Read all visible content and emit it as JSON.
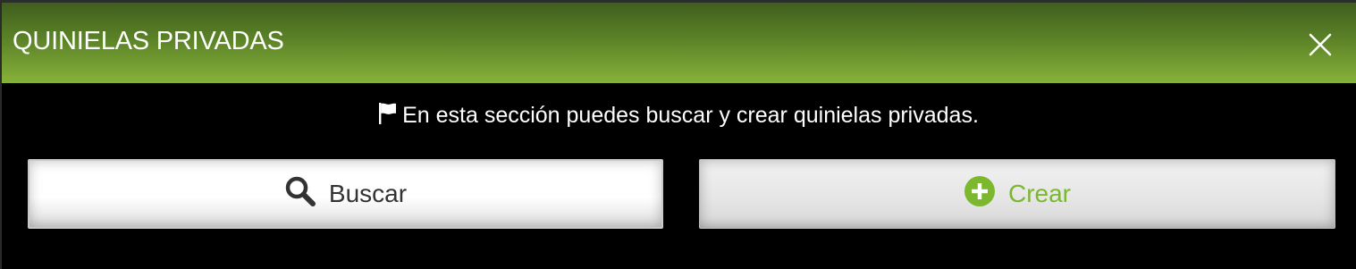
{
  "modal": {
    "title": "QUINIELAS PRIVADAS",
    "close_icon": "close-icon",
    "header_gradient": [
      "#3f5e1e",
      "#86b23a"
    ]
  },
  "notice": {
    "icon": "flag-icon",
    "text": "En esta sección puedes buscar y crear quinielas privadas."
  },
  "actions": {
    "search": {
      "label": "Buscar",
      "icon": "search-icon",
      "color": "#333333"
    },
    "create": {
      "label": "Crear",
      "icon": "plus-circle-icon",
      "color": "#7bb82e"
    }
  }
}
